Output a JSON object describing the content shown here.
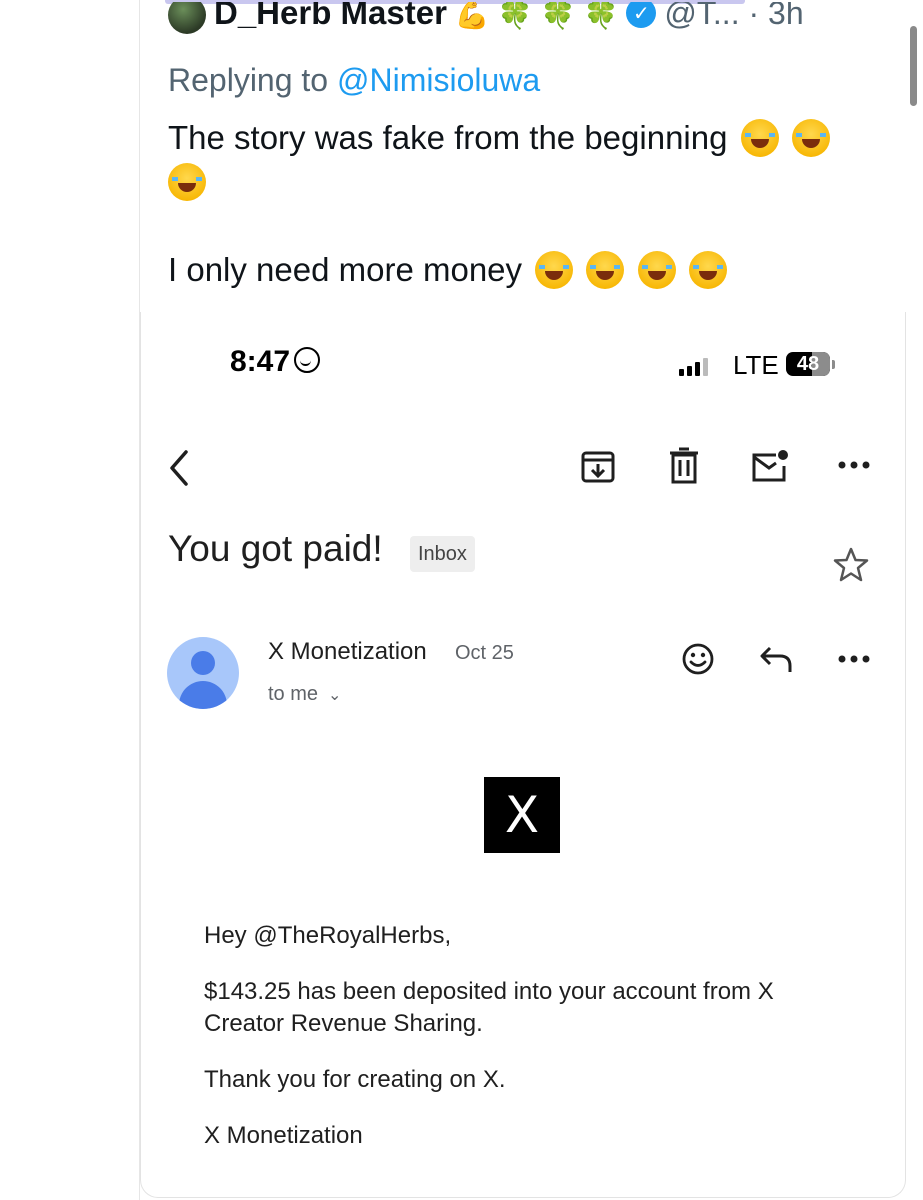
{
  "tweet": {
    "display_name": "D_Herb Master",
    "emojis": [
      "💪",
      "🍀",
      "🍀",
      "🍀"
    ],
    "handle_time": "@T... · 3h",
    "replying_prefix": "Replying to",
    "replying_mention": "@Nimisioluwa",
    "line1": "The story was fake from the beginning",
    "line2": "I only need more money"
  },
  "phone_status": {
    "time": "8:47",
    "network": "LTE",
    "battery": "48"
  },
  "email": {
    "subject": "You got paid!",
    "label": "Inbox",
    "sender": "X Monetization",
    "date": "Oct 25",
    "recipient": "to me",
    "logo": "X",
    "greeting": "Hey @TheRoyalHerbs,",
    "message": "$143.25 has been deposited into your account from X Creator Revenue Sharing.",
    "thanks": "Thank you for creating on X.",
    "signature": "X Monetization"
  },
  "icons": {
    "back": "back-arrow-icon",
    "archive": "archive-icon",
    "delete": "trash-icon",
    "mark_unread": "mail-unread-icon",
    "more": "more-icon",
    "star": "star-icon",
    "react": "emoji-react-icon",
    "reply": "reply-icon"
  },
  "colors": {
    "link": "#1d9bf0",
    "muted": "#536471",
    "avatar_bg": "#a8c7fa",
    "avatar_fg": "#4a7ce8"
  }
}
